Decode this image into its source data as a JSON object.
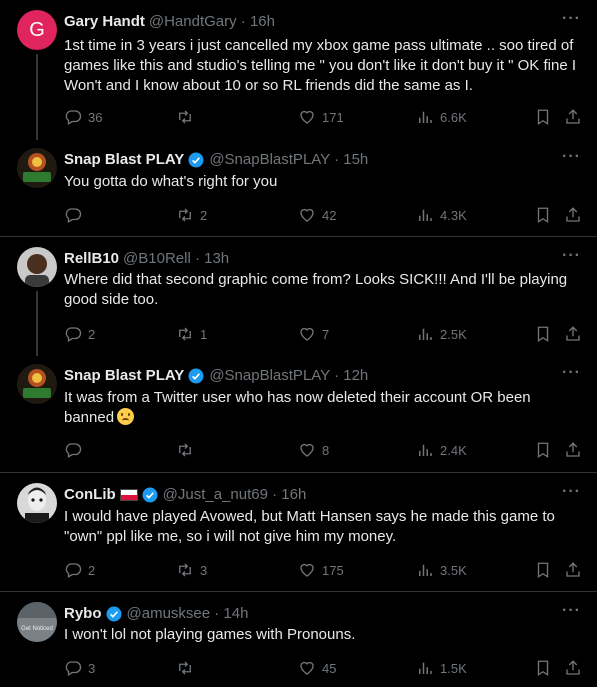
{
  "tweets": [
    {
      "name": "Gary Handt",
      "handle": "@HandtGary · 16h",
      "avatar_letter": "G",
      "verified": false,
      "text": "1st time in 3 years i just cancelled my xbox game pass ultimate .. soo tired of games like this and studio's telling me \" you don't like it don't buy it \" OK fine I Won't and I know about 10 or so RL friends did the same as I.",
      "replies": "36",
      "retweets": "",
      "likes": "171",
      "views": "6.6K"
    },
    {
      "name": "Snap Blast PLAY",
      "handle": "@SnapBlastPLAY · 15h",
      "verified": true,
      "text": "You gotta do what's right for you",
      "replies": "",
      "retweets": "2",
      "likes": "42",
      "views": "4.3K"
    },
    {
      "name": "RellB10",
      "handle": "@B10Rell · 13h",
      "verified": false,
      "text": "Where did that second graphic come from? Looks SICK!!! And I'll be playing good side too.",
      "replies": "2",
      "retweets": "1",
      "likes": "7",
      "views": "2.5K"
    },
    {
      "name": "Snap Blast PLAY",
      "handle": "@SnapBlastPLAY · 12h",
      "verified": true,
      "text": "It was from a Twitter user who has now deleted their account OR been banned",
      "replies": "",
      "retweets": "",
      "likes": "8",
      "views": "2.4K"
    },
    {
      "name": "ConLib",
      "handle": "@Just_a_nut69 · 16h",
      "verified": true,
      "text": "I would have played Avowed, but Matt Hansen says he made this game to \"own\" ppl like me, so i will not give him my money.",
      "replies": "2",
      "retweets": "3",
      "likes": "175",
      "views": "3.5K"
    },
    {
      "name": "Rybo",
      "handle": "@amusksee · 14h",
      "verified": true,
      "avatar_text": "Get Noticed",
      "text": "I won't lol not playing games with Pronouns.",
      "replies": "3",
      "retweets": "",
      "likes": "45",
      "views": "1.5K"
    }
  ],
  "colors": {
    "verified": "#1d9bf0",
    "muted": "#71767b",
    "divider": "#2f3336"
  }
}
